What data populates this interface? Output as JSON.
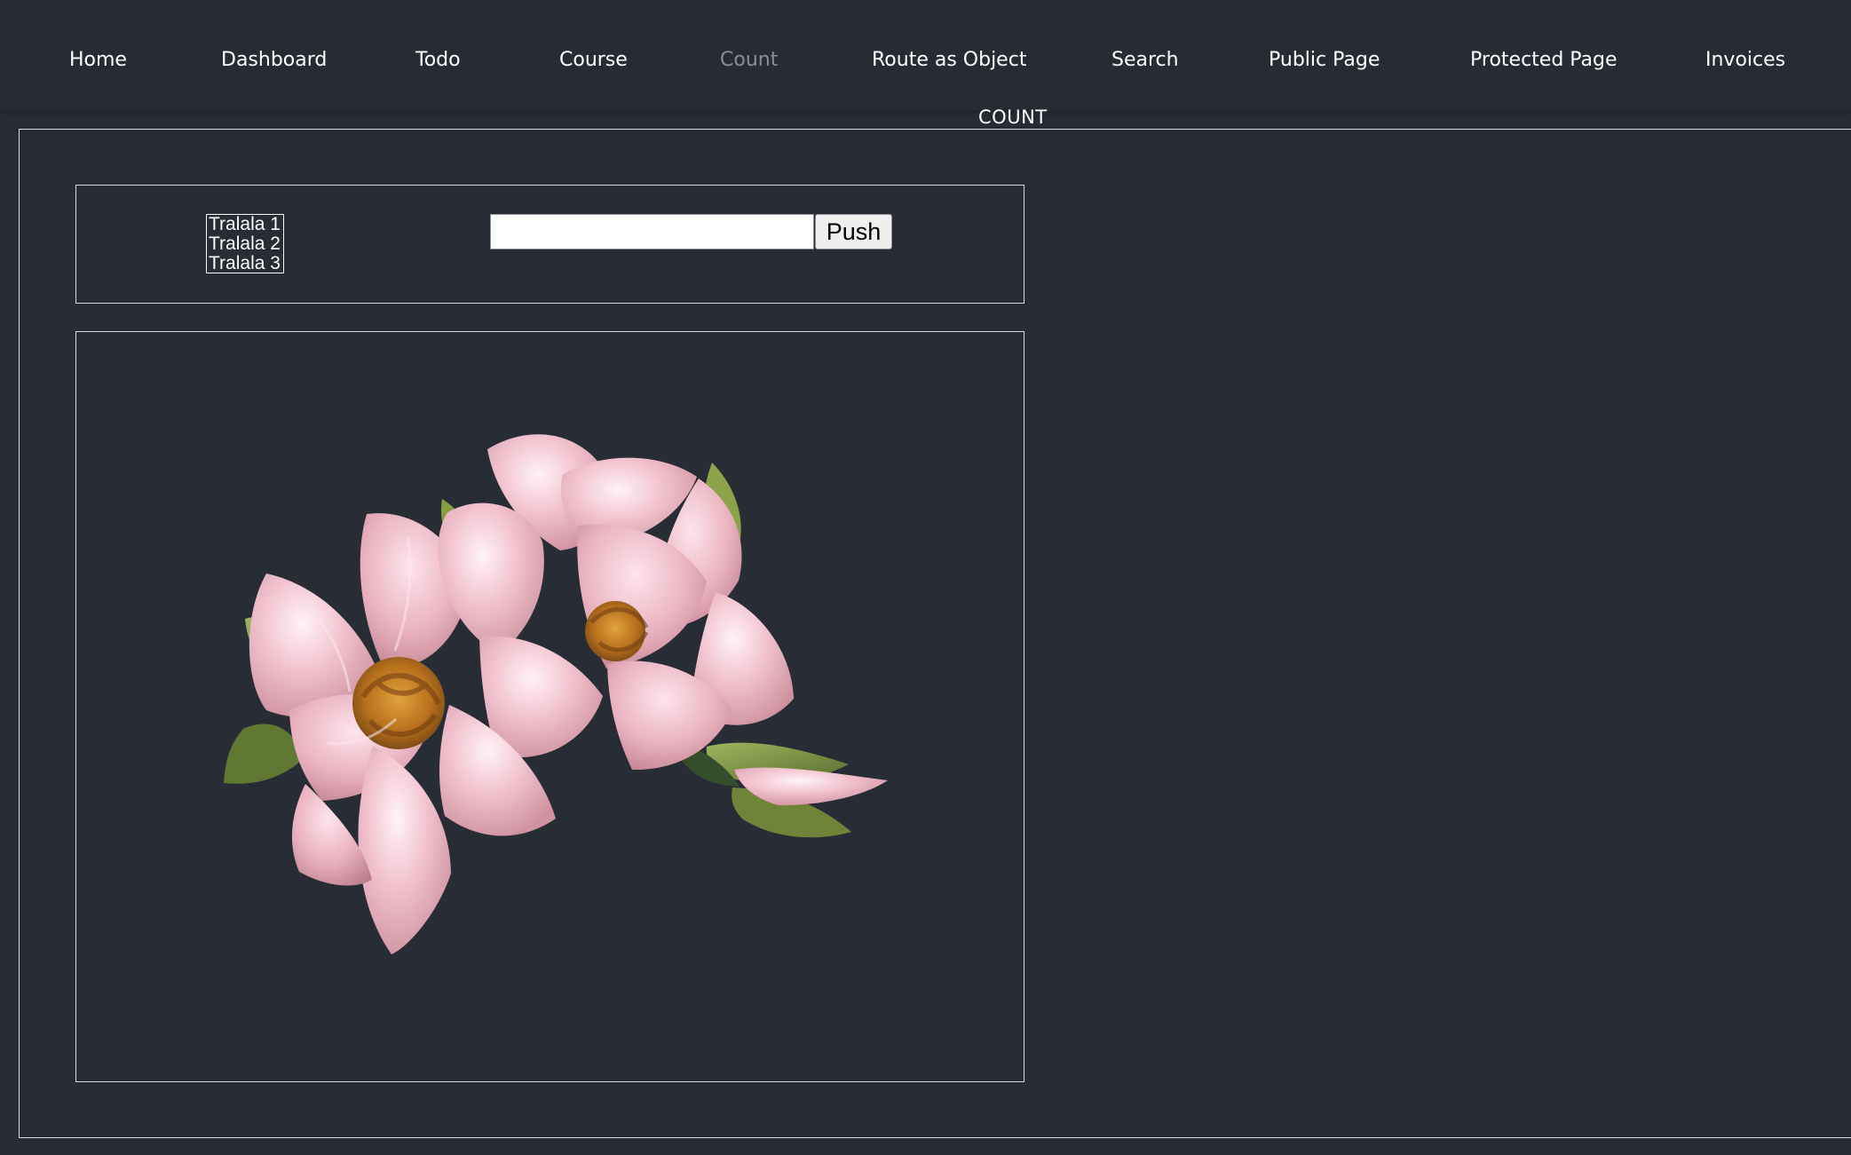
{
  "navigation": {
    "items": [
      {
        "label": "Home"
      },
      {
        "label": "Dashboard"
      },
      {
        "label": "Todo"
      },
      {
        "label": "Course"
      },
      {
        "label": "Count",
        "active": true
      },
      {
        "label": "Route as Object"
      },
      {
        "label": "Search"
      },
      {
        "label": "Public Page"
      },
      {
        "label": "Protected Page"
      },
      {
        "label": "Invoices"
      }
    ]
  },
  "page": {
    "title": "COUNT"
  },
  "controls": {
    "list_items": [
      "Tralala 1",
      "Tralala 2",
      "Tralala 3"
    ],
    "input_value": "",
    "input_placeholder": "",
    "push_label": "Push"
  },
  "image": {
    "subject": "pink-magnolia-flowers"
  },
  "colors": {
    "background": "#282c34",
    "active_nav": "#8b8e94",
    "text": "#ffffff",
    "border": "#d8dade"
  }
}
